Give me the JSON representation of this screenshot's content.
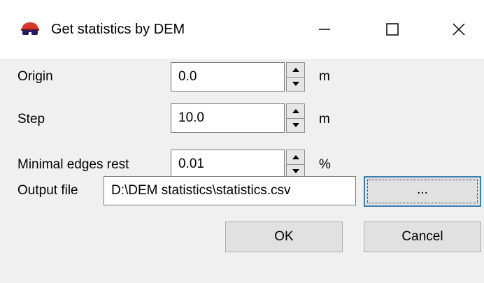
{
  "window": {
    "title": "Get statistics by DEM",
    "icons": {
      "app": "dem-app-icon",
      "minimize": "minimize-icon",
      "maximize": "maximize-icon",
      "close": "close-icon"
    }
  },
  "fields": {
    "origin": {
      "label": "Origin",
      "value": "0.0",
      "unit": "m"
    },
    "step": {
      "label": "Step",
      "value": "10.0",
      "unit": "m"
    },
    "min_edges": {
      "label": "Minimal edges rest",
      "value": "0.01",
      "unit": "%"
    },
    "output": {
      "label": "Output file",
      "value": "D:\\DEM statistics\\statistics.csv"
    }
  },
  "buttons": {
    "browse": "...",
    "ok": "OK",
    "cancel": "Cancel"
  },
  "colors": {
    "background": "#f0f0f0",
    "titlebar": "#ffffff",
    "focus_border": "#3c7fb1"
  }
}
